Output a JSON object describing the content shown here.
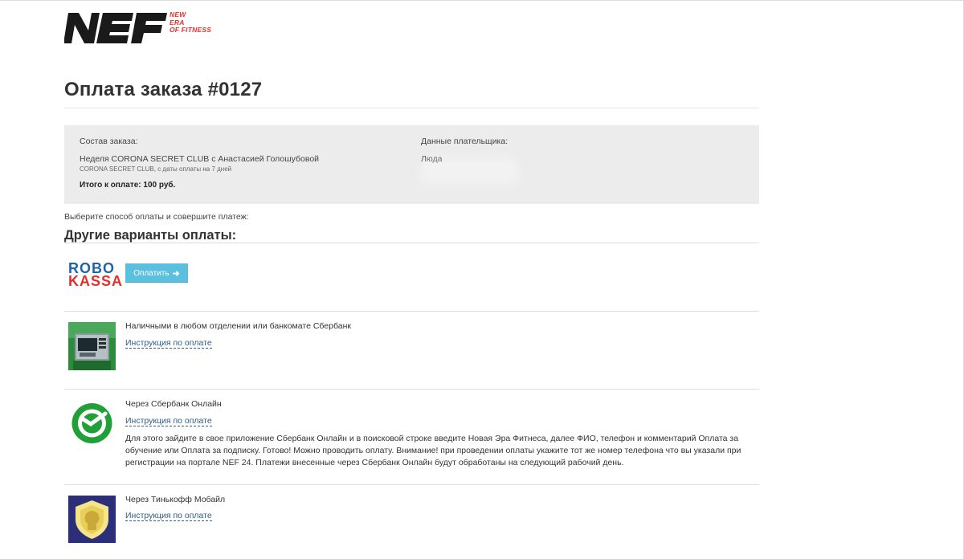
{
  "brand": {
    "tagline": [
      "NEW",
      "ERA",
      "OF FITNESS"
    ],
    "primary_color": "#1a1a1a",
    "accent_color": "#e4322b"
  },
  "page": {
    "title": "Оплата заказа #0127"
  },
  "order": {
    "composition_label": "Состав заказа:",
    "item_name": "Неделя CORONA SECRET CLUB с Анастасией Голошубовой",
    "item_sub": "CORONA SECRET CLUB, с даты оплаты на 7 дней",
    "total": "Итого к оплате: 100 руб.",
    "payer_label": "Данные плательщика:",
    "payer_name": "Люда"
  },
  "payment": {
    "hint": "Выберите способ оплаты и совершите платеж:",
    "section_title": "Другие варианты оплаты:",
    "robokassa": {
      "logo_line1": "ROBO",
      "logo_line2": "KASSA",
      "button_label": "Оплатить",
      "button_icon": "arrow-right-icon",
      "button_color": "#5bc0de"
    },
    "methods": [
      {
        "title": "Наличными в любом отделении или банкомате Сбербанк",
        "link": "Инструкция по оплате",
        "icon": "atm-icon"
      },
      {
        "title": "Через Сбербанк Онлайн",
        "link": "Инструкция по оплате",
        "icon": "sberbank-icon",
        "description": "Для этого зайдите в свое приложение Сбербанк Онлайн и в поисковой строке введите Новая Эра Фитнеса, далее ФИО, телефон и комментарий Оплата за обучение или Оплата за подписку. Готово! Можно проводить оплату. Внимание! при проведении оплаты укажите тот же номер телефона что вы указали при регистрации на портале NEF 24. Платежи внесенные через Сбербанк Онлайн будут обработаны на следующий рабочий день."
      },
      {
        "title": "Через Тинькофф Мобайл",
        "link": "Инструкция по оплате",
        "icon": "tinkoff-icon"
      }
    ]
  }
}
